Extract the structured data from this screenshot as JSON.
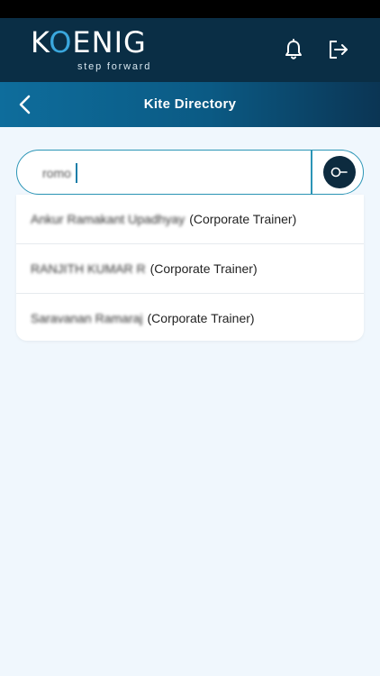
{
  "header": {
    "logo_text_a": "K",
    "logo_text_o": "O",
    "logo_text_b": "ENIG",
    "tagline": "step forward",
    "icons": [
      "bell-icon",
      "logout-icon"
    ]
  },
  "subheader": {
    "title": "Kite Directory",
    "back_icon": "chevron-left-icon"
  },
  "search": {
    "value": "romo",
    "button_icon": "search-key-icon"
  },
  "results": [
    {
      "name": "Ankur Ramakant Upadhyay",
      "role": "(Corporate Trainer)"
    },
    {
      "name": "RANJITH KUMAR R",
      "role": "(Corporate Trainer)"
    },
    {
      "name": "Saravanan Ramaraj",
      "role": "(Corporate Trainer)"
    }
  ],
  "colors": {
    "topbar": "#0a2e45",
    "accent": "#2b95b6",
    "background": "#f0f7fd"
  }
}
